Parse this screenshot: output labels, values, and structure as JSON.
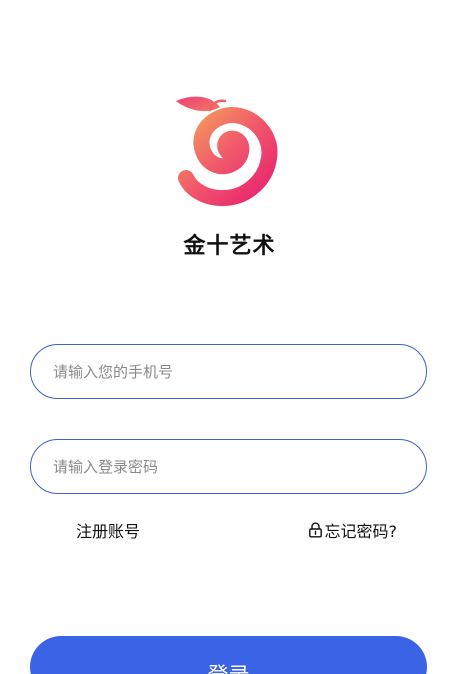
{
  "app": {
    "name": "金十艺术",
    "logo_icon": "peach-swirl-logo-icon",
    "accent_color": "#3b63e6",
    "border_color": "#3d63c9"
  },
  "login_form": {
    "phone_placeholder": "请输入您的手机号",
    "phone_value": "",
    "password_placeholder": "请输入登录密码",
    "password_value": ""
  },
  "links": {
    "register_label": "注册账号",
    "forgot_label": "忘记密码?",
    "forgot_icon": "lock-icon"
  },
  "actions": {
    "login_label": "登录"
  }
}
